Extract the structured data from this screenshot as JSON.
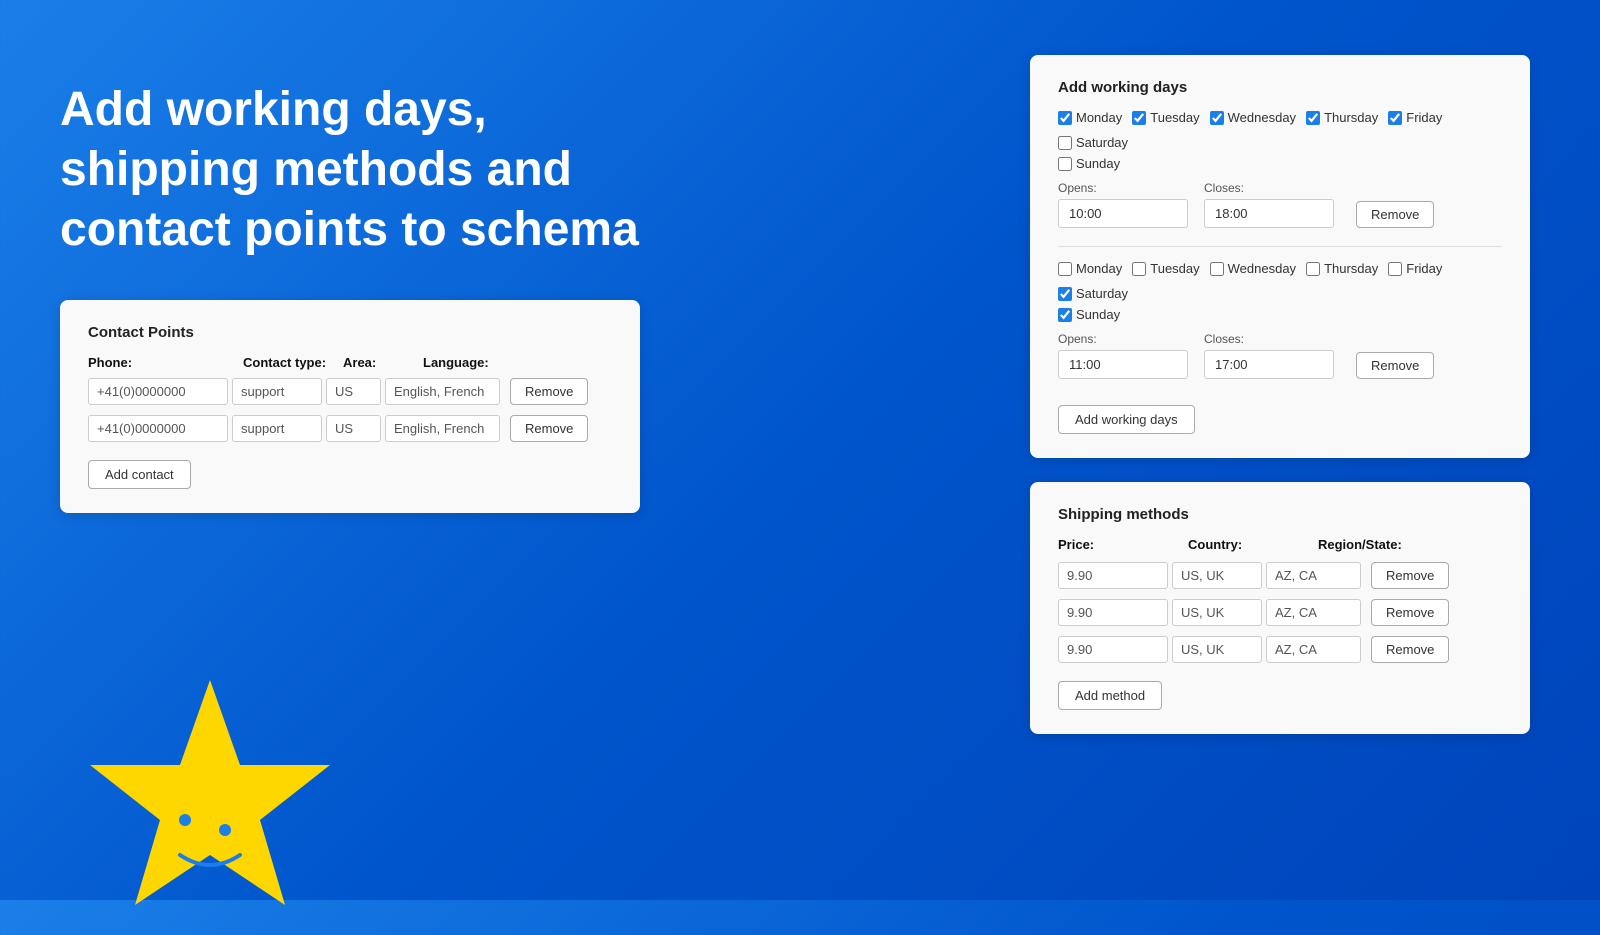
{
  "hero": {
    "title": "Add working days, shipping methods and contact points to schema"
  },
  "contact_points": {
    "title": "Contact Points",
    "headers": {
      "phone": "Phone:",
      "contact_type": "Contact type:",
      "area": "Area:",
      "language": "Language:"
    },
    "rows": [
      {
        "phone": "+41(0)0000000",
        "contact_type": "support",
        "area": "US",
        "language": "English, French"
      },
      {
        "phone": "+41(0)0000000",
        "contact_type": "support",
        "area": "US",
        "language": "English, French"
      }
    ],
    "add_label": "Add contact"
  },
  "working_days": {
    "title": "Add working days",
    "sections": [
      {
        "days": [
          {
            "label": "Monday",
            "checked": true
          },
          {
            "label": "Tuesday",
            "checked": true
          },
          {
            "label": "Wednesday",
            "checked": true
          },
          {
            "label": "Thursday",
            "checked": true
          },
          {
            "label": "Friday",
            "checked": true
          },
          {
            "label": "Saturday",
            "checked": false
          },
          {
            "label": "Sunday",
            "checked": false
          }
        ],
        "opens_label": "Opens:",
        "closes_label": "Closes:",
        "opens_value": "10:00",
        "closes_value": "18:00",
        "remove_label": "Remove"
      },
      {
        "days": [
          {
            "label": "Monday",
            "checked": false
          },
          {
            "label": "Tuesday",
            "checked": false
          },
          {
            "label": "Wednesday",
            "checked": false
          },
          {
            "label": "Thursday",
            "checked": false
          },
          {
            "label": "Friday",
            "checked": false
          },
          {
            "label": "Saturday",
            "checked": true
          },
          {
            "label": "Sunday",
            "checked": true
          }
        ],
        "opens_label": "Opens:",
        "closes_label": "Closes:",
        "opens_value": "11:00",
        "closes_value": "17:00",
        "remove_label": "Remove"
      }
    ],
    "add_label": "Add working days"
  },
  "shipping_methods": {
    "title": "Shipping methods",
    "headers": {
      "price": "Price:",
      "country": "Country:",
      "region": "Region/State:"
    },
    "rows": [
      {
        "price": "9.90",
        "country": "US, UK",
        "region": "AZ, CA"
      },
      {
        "price": "9.90",
        "country": "US, UK",
        "region": "AZ, CA"
      },
      {
        "price": "9.90",
        "country": "US, UK",
        "region": "AZ, CA"
      }
    ],
    "remove_label": "Remove",
    "add_label": "Add method"
  }
}
